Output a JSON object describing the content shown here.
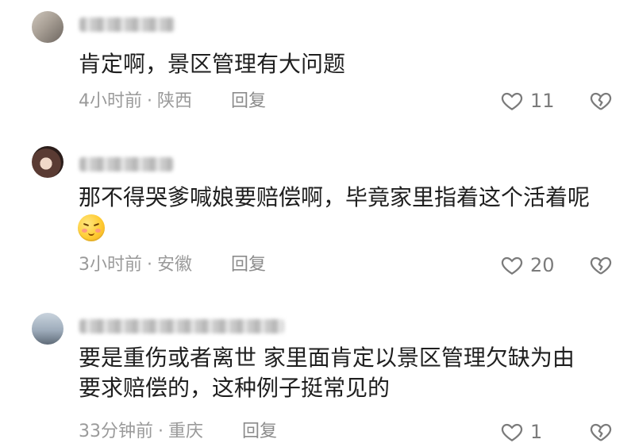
{
  "comments": [
    {
      "content": "肯定啊，景区管理有大问题",
      "time": "4小时前",
      "location": "陕西",
      "reply_label": "回复",
      "like_count": "11"
    },
    {
      "content": "那不得哭爹喊娘要赔偿啊，毕竟家里指着这个活着呢",
      "time": "3小时前",
      "location": "安徽",
      "reply_label": "回复",
      "like_count": "20"
    },
    {
      "content": "要是重伤或者离世 家里面肯定以景区管理欠缺为由\n要求赔偿的，这种例子挺常见的",
      "time": "33分钟前",
      "location": "重庆",
      "reply_label": "回复",
      "like_count": "1"
    }
  ],
  "icons": {
    "like": "heart-outline-icon",
    "dislike": "broken-heart-icon",
    "emoji": "shy-face-emoji-icon"
  },
  "colors": {
    "text_primary": "#1f1f1f",
    "text_secondary": "#9a9a9a",
    "icon_gray": "#7b7b7b",
    "background": "#ffffff"
  }
}
